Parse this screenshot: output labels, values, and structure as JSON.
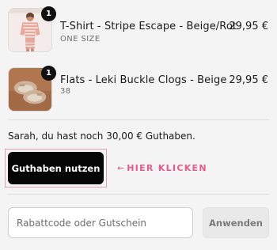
{
  "cart": {
    "items": [
      {
        "quantity": "1",
        "title": "T-Shirt - Stripe Escape - Beige/Rot",
        "variant": "ONE SIZE",
        "price": "29,95 €"
      },
      {
        "quantity": "1",
        "title": "Flats - Leki Buckle Clogs - Beige",
        "variant": "38",
        "price": "29,95 €"
      }
    ]
  },
  "credit": {
    "message": "Sarah, du hast noch 30,00 € Guthaben.",
    "button_label": "Guthaben nutzen",
    "hint_arrow": "←",
    "hint_label": "HIER KLICKEN"
  },
  "discount": {
    "placeholder": "Rabattcode oder Gutschein",
    "apply_label": "Anwenden"
  },
  "colors": {
    "accent_pink": "#e85a8c",
    "primary_button": "#050505",
    "background": "#f4f4f4"
  }
}
